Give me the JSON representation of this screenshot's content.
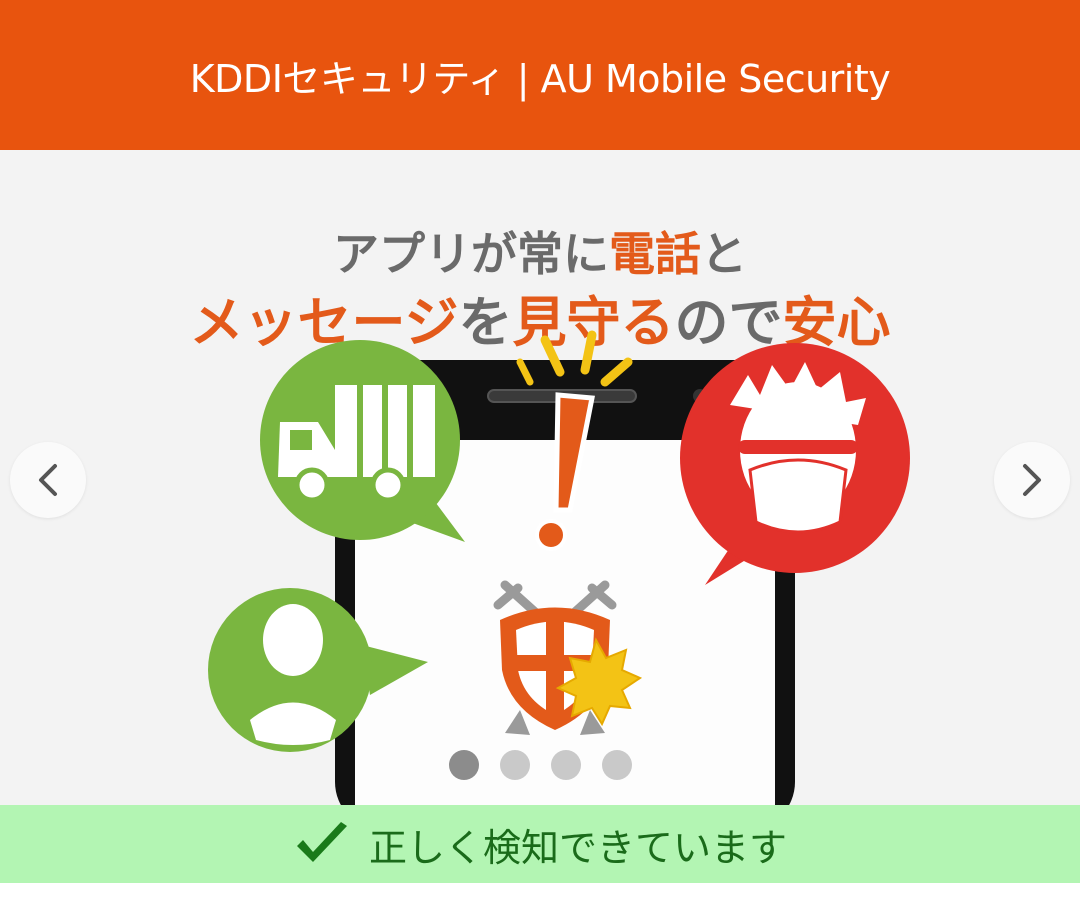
{
  "header": {
    "title": "KDDIセキュリティ | AU Mobile Security"
  },
  "banner": {
    "line1_a": "アプリが常に",
    "line1_b": "電話",
    "line1_c": "と",
    "line2_a": "メッセージ",
    "line2_b": "を",
    "line2_c": "見守る",
    "line2_d": "ので",
    "line2_e": "安心"
  },
  "carousel": {
    "prev_icon": "chevron-left-icon",
    "next_icon": "chevron-right-icon",
    "slide_count": 4,
    "active_index": 0
  },
  "status": {
    "text": "正しく検知できています",
    "icon": "checkmark-icon"
  },
  "colors": {
    "header_bg": "#e8540e",
    "accent_orange": "#e35a1a",
    "green_bubble": "#7ab640",
    "red_bubble": "#e2312b",
    "status_bg": "#b3f5b3",
    "status_text": "#1a6b1a"
  }
}
